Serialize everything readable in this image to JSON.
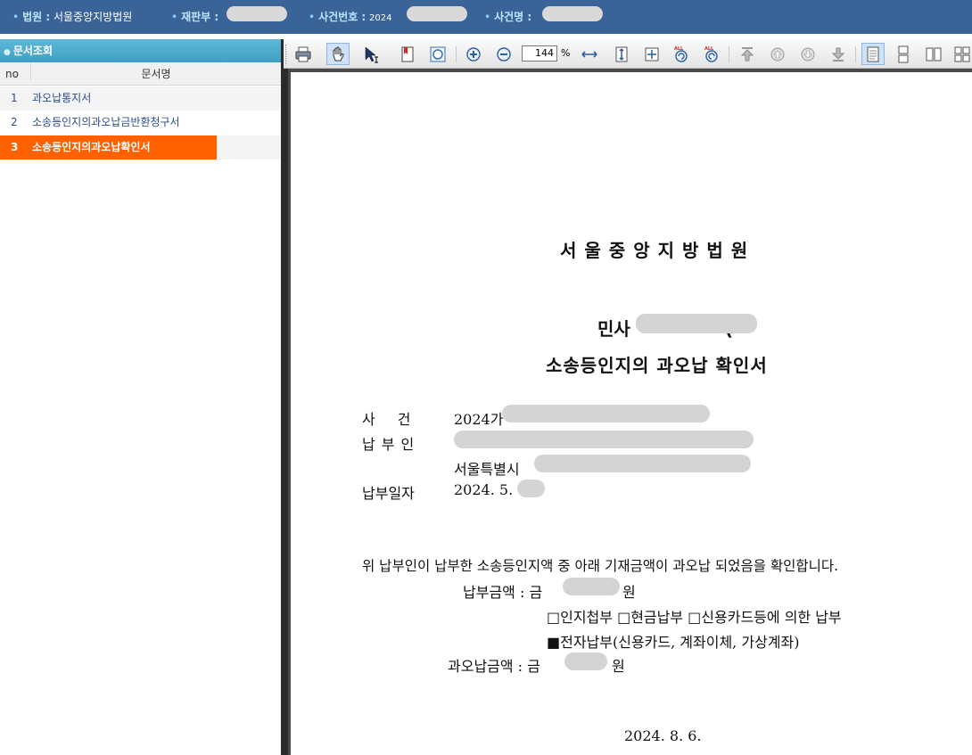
{
  "header": {
    "court_label": "법원 :",
    "court_value": "서울중앙지방법원",
    "panel_label": "재판부 :",
    "case_no_label": "사건번호 :",
    "case_no_value": "2024",
    "case_name_label": "사건명 :"
  },
  "sidebar": {
    "title": "문서조회",
    "col_no": "no",
    "col_name": "문서명",
    "rows": [
      {
        "no": "1",
        "name": "과오납통지서"
      },
      {
        "no": "2",
        "name": "소송등인지의과오납금반환청구서"
      },
      {
        "no": "3",
        "name": "소송등인지의과오납확인서"
      }
    ],
    "selected_index": 3
  },
  "toolbar": {
    "zoom_value": "144",
    "zoom_unit": "%",
    "icons": [
      "print-icon",
      "hand-pan-icon",
      "text-select-icon",
      "bookmark-icon",
      "shape-icon",
      "zoom-in-icon",
      "zoom-out-icon",
      "fit-width-icon",
      "fit-height-icon",
      "fit-page-icon",
      "rotate-left-all-icon",
      "rotate-right-all-icon",
      "first-page-icon",
      "prev-page-icon",
      "next-page-icon",
      "last-page-icon",
      "single-page-icon",
      "continuous-page-icon",
      "two-page-icon",
      "grid-view-icon"
    ]
  },
  "document": {
    "court": "서울중앙지방법원",
    "case_prefix": "민사",
    "case_tail": "(",
    "title": "소송등인지의 과오납 확인서",
    "case_label": "사  건",
    "case_value": "2024가",
    "payer_label": "납부인",
    "payer_address": "서울특별시",
    "pay_date_label": "납부일자",
    "pay_date_value": "2024. 5.",
    "statement": "위 납부인이 납부한 소송등인지액 중 아래 기재금액이 과오납 되었음을 확인합니다.",
    "pay_amount_label": "납부금액 : 금",
    "pay_amount_unit": "원",
    "pay_methods_line1": "□인지첩부 □현금납부 □신용카드등에 의한 납부",
    "pay_methods_line2": "■전자납부(신용카드, 계좌이체, 가상계좌)",
    "over_amount_label": "과오납금액 : 금",
    "over_amount_unit": "원",
    "issue_date": "2024.  8.  6."
  }
}
